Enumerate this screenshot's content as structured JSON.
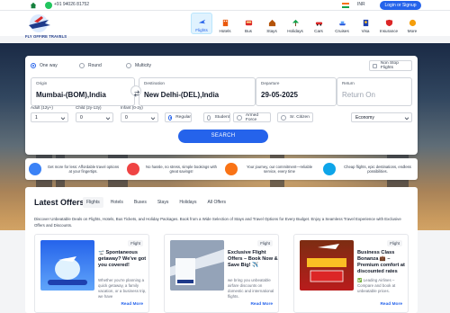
{
  "topbar": {
    "phone": "+91 94026 81752",
    "currency": "INR",
    "login_label": "Login or Signup"
  },
  "logo": {
    "text": "FLY OFFIRE TRAVELS"
  },
  "nav": [
    {
      "label": "Flights",
      "icon": "plane-icon",
      "active": true
    },
    {
      "label": "Hotels",
      "icon": "hotel-icon"
    },
    {
      "label": "Bus",
      "icon": "bus-icon"
    },
    {
      "label": "Stays",
      "icon": "stays-icon"
    },
    {
      "label": "Holidays",
      "icon": "holidays-icon"
    },
    {
      "label": "Cars",
      "icon": "car-icon"
    },
    {
      "label": "Cruises",
      "icon": "cruise-icon"
    },
    {
      "label": "Visa",
      "icon": "visa-icon"
    },
    {
      "label": "Insurance",
      "icon": "insurance-icon"
    },
    {
      "label": "More",
      "icon": "more-icon"
    }
  ],
  "search": {
    "trip_types": [
      "One way",
      "Round",
      "Multicity"
    ],
    "selected_trip": "One way",
    "non_stop_label": "Non Stop Flights",
    "origin": {
      "label": "Origin",
      "value": "Mumbai-(BOM),India"
    },
    "destination": {
      "label": "Destination",
      "value": "New Delhi-(DEL),India"
    },
    "departure": {
      "label": "Departure",
      "value": "29-05-2025"
    },
    "return": {
      "label": "Return",
      "value": "Return On"
    },
    "adult": {
      "label": "Adult (12y+)",
      "value": "1"
    },
    "child": {
      "label": "Child (2y-12y)",
      "value": "0"
    },
    "infant": {
      "label": "Infant (0-2y)",
      "value": "0"
    },
    "fares": [
      "Regular",
      "Student",
      "Armed Force",
      "Sr. Citizen"
    ],
    "selected_fare": "Regular",
    "cabin": "Economy",
    "button_label": "SEARCH"
  },
  "features": [
    {
      "text": "Get more for less: Affordable travel options at your fingertips.",
      "icon": "globe-icon"
    },
    {
      "text": "No hassle, no stress, simple bookings with great savings!",
      "icon": "plane-icon"
    },
    {
      "text": "Your journey, our commitment—reliable service, every time",
      "icon": "person-icon"
    },
    {
      "text": "Cheap flights, epic destinations, endless possibilities.",
      "icon": "flights-icon"
    }
  ],
  "offers": {
    "title": "Latest Offers",
    "tabs": [
      "Flights",
      "Hotels",
      "Buses",
      "Stays",
      "Holidays",
      "All Offers"
    ],
    "active_tab": "Flights",
    "description": "Discover Unbeatable Deals on Flights, Hotels, Bus Tickets, and Holiday Packages. Book from a Wide Selection of Stays and Travel Options for Every Budget. Enjoy a Seamless Travel Experience with Exclusive Offers and Discounts.",
    "cards": [
      {
        "badge": "Flight",
        "title": "🛫 Spontaneous getaway? We've got you covered!",
        "subtitle": "Whether you're planning a quick getaway, a family vacation, or a business trip, we have",
        "more": "Read More",
        "image_text": "Book Your Flight"
      },
      {
        "badge": "Flight",
        "title": "Exclusive Flight Offers – Book Now & Save Big! ✈️",
        "subtitle": "we bring you unbeatable airfare discounts on domestic and international flights.",
        "more": "Read More",
        "image_text": "Trust our travel agency"
      },
      {
        "badge": "Flight",
        "title": "Business Class Bonanza 💼 – Premium comfort at discounted rates",
        "subtitle": "✅ Leading Airlines – Compare and book at unbeatable prices.",
        "more": "Read More",
        "image_text": "FLIGHT TICKET UPTO 15% OFF"
      }
    ]
  }
}
